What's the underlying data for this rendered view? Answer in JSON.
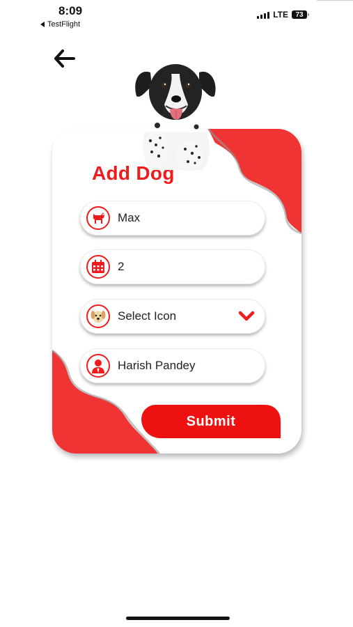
{
  "status_bar": {
    "time": "8:09",
    "back_app": "TestFlight",
    "network": "LTE",
    "battery": "73"
  },
  "header": {
    "back_icon": "arrow-left-icon"
  },
  "form": {
    "title": "Add Dog",
    "name": {
      "value": "Max",
      "icon": "dog-icon"
    },
    "age": {
      "value": "2",
      "icon": "calendar-icon"
    },
    "icon_select": {
      "value": "Select Icon",
      "icon": "dog-face-icon",
      "chevron": "chevron-down-icon"
    },
    "owner": {
      "value": "Harish Pandey",
      "icon": "person-icon"
    },
    "submit_label": "Submit"
  },
  "colors": {
    "accent": "#ee1c1c",
    "wave": "#f03333",
    "text": "#222222"
  }
}
